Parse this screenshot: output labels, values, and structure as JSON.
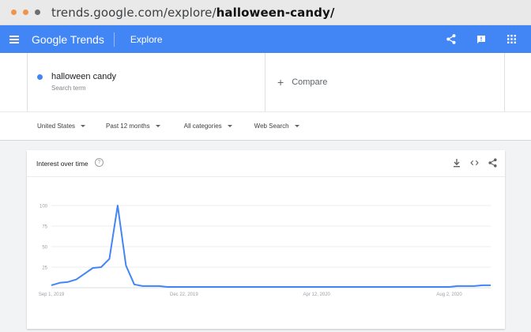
{
  "browser": {
    "url_prefix": "trends.google.com/explore/",
    "url_path": "halloween-candy/",
    "dot_colors": [
      "#f0944a",
      "#f0944a",
      "#6e6e6e"
    ]
  },
  "header": {
    "logo": "Google Trends",
    "page": "Explore",
    "bg_color": "#4285f4"
  },
  "term": {
    "label": "halloween candy",
    "sublabel": "Search term",
    "color": "#4285f4"
  },
  "compare": {
    "label": "Compare",
    "icon": "plus-icon"
  },
  "filters": [
    {
      "label": "United States"
    },
    {
      "label": "Past 12 months"
    },
    {
      "label": "All categories"
    },
    {
      "label": "Web Search"
    }
  ],
  "card": {
    "title": "Interest over time",
    "help": "?",
    "actions": [
      "download-icon",
      "embed-icon",
      "share-icon"
    ]
  },
  "chart_data": {
    "type": "line",
    "title": "Interest over time",
    "xlabel": "",
    "ylabel": "",
    "ylim": [
      0,
      100
    ],
    "yticks": [
      25,
      50,
      75,
      100
    ],
    "grid": true,
    "xtick_labels": [
      {
        "index": 0,
        "label": "Sep 1, 2019"
      },
      {
        "index": 16,
        "label": "Dec 22, 2019"
      },
      {
        "index": 32,
        "label": "Apr 12, 2020"
      },
      {
        "index": 48,
        "label": "Aug 2, 2020"
      }
    ],
    "series": [
      {
        "color": "#4285f4",
        "values": [
          3,
          6,
          7,
          10,
          17,
          24,
          25,
          35,
          100,
          27,
          4,
          2,
          2,
          2,
          1,
          1,
          1,
          1,
          1,
          1,
          1,
          1,
          1,
          1,
          1,
          1,
          1,
          1,
          1,
          1,
          1,
          1,
          1,
          1,
          1,
          1,
          1,
          1,
          1,
          1,
          1,
          1,
          1,
          1,
          1,
          1,
          1,
          1,
          1,
          2,
          2,
          2,
          3,
          3
        ]
      }
    ]
  }
}
